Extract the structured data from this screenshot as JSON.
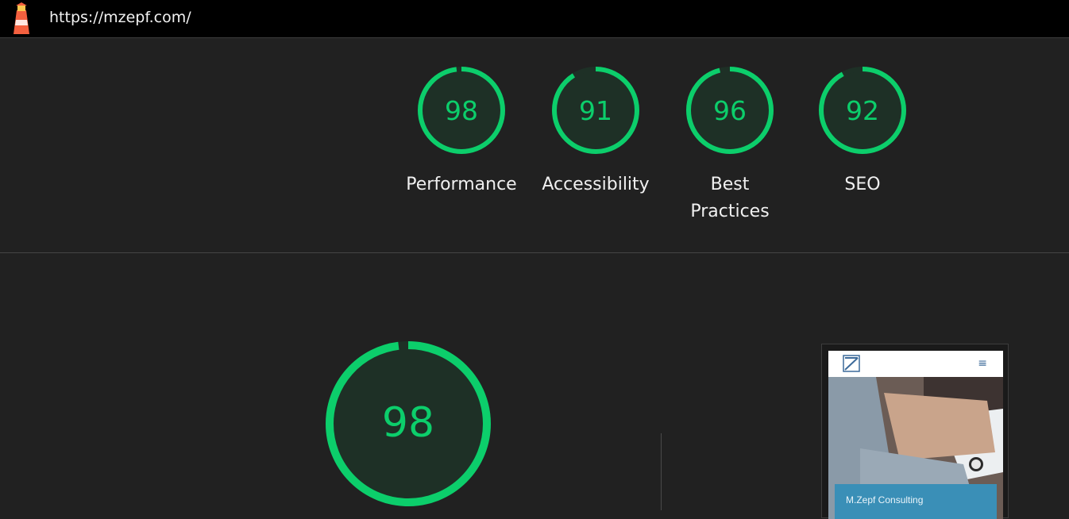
{
  "header": {
    "url": "https://mzepf.com/",
    "logo_icon": "lighthouse-icon"
  },
  "categories": [
    {
      "score": "98",
      "label_lines": [
        "Performance"
      ],
      "fraction": 0.98
    },
    {
      "score": "91",
      "label_lines": [
        "Accessibility"
      ],
      "fraction": 0.91
    },
    {
      "score": "96",
      "label_lines": [
        "Best",
        "Practices"
      ],
      "fraction": 0.96
    },
    {
      "score": "92",
      "label_lines": [
        "SEO"
      ],
      "fraction": 0.92
    }
  ],
  "main_gauge": {
    "score": "98",
    "fraction": 0.98
  },
  "screenshot": {
    "banner_text": "M.Zepf Consulting",
    "menu_icon": "hamburger-menu-icon",
    "logo_icon": "site-logo-icon"
  },
  "colors": {
    "pass_green": "#0cce6b",
    "gauge_fill": "#1e3026",
    "background": "#212121",
    "topbar": "#000000"
  }
}
